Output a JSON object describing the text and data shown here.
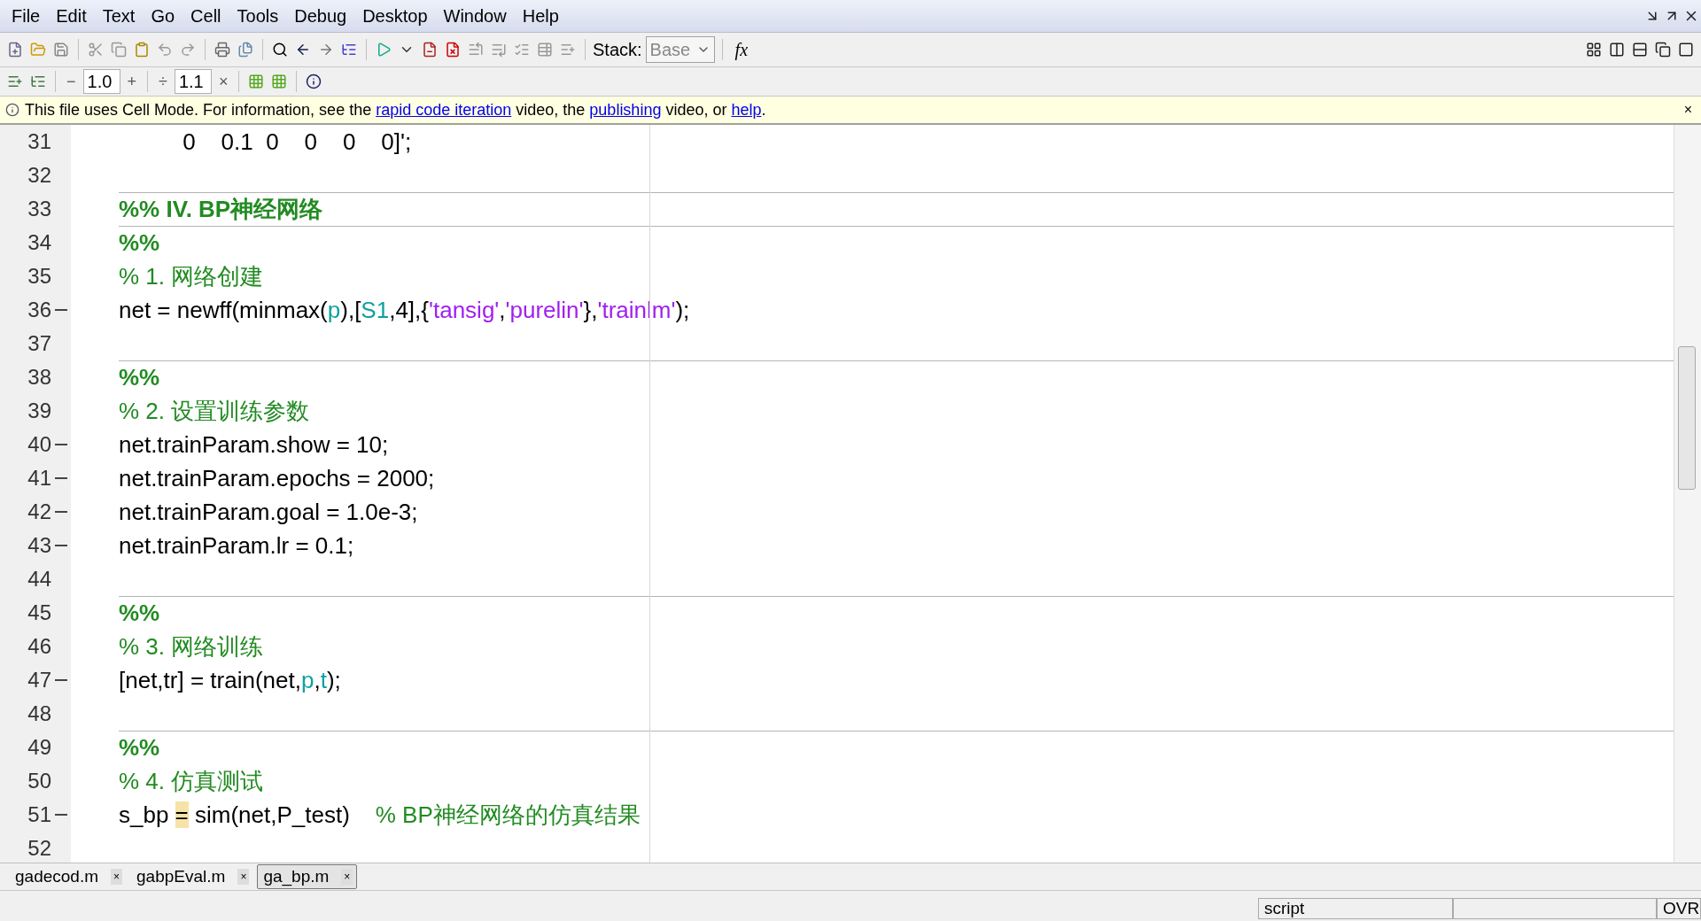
{
  "menu": [
    "File",
    "Edit",
    "Text",
    "Go",
    "Cell",
    "Tools",
    "Debug",
    "Desktop",
    "Window",
    "Help"
  ],
  "toolbar": {
    "stack_label": "Stack:",
    "stack_value": "Base",
    "function_button": "fx"
  },
  "cell_toolbar": {
    "minus": "−",
    "decrement": "1.0",
    "plus": "+",
    "divide": "÷",
    "factor": "1.1",
    "times": "×"
  },
  "info_bar": {
    "parts": [
      {
        "kind": "text",
        "text": "This file uses Cell Mode. For information, see the "
      },
      {
        "kind": "link",
        "text": "rapid code iteration"
      },
      {
        "kind": "text",
        "text": " video, the "
      },
      {
        "kind": "link",
        "text": "publishing"
      },
      {
        "kind": "text",
        "text": " video, or "
      },
      {
        "kind": "link",
        "text": "help"
      },
      {
        "kind": "text",
        "text": "."
      }
    ],
    "close": "×"
  },
  "lines": [
    {
      "number": "31",
      "executable": false,
      "tokens": [
        {
          "kind": "code",
          "text": "          0    0.1  0    0    0    0]';"
        }
      ]
    },
    {
      "number": "32",
      "executable": false
    },
    {
      "number": "33",
      "executable": false,
      "tokens": [
        {
          "kind": "cell",
          "text": "%% IV. BP神经网络"
        }
      ]
    },
    {
      "number": "34",
      "executable": false,
      "tokens": [
        {
          "kind": "cell",
          "text": "%%"
        }
      ]
    },
    {
      "number": "35",
      "executable": false,
      "tokens": [
        {
          "kind": "comment",
          "text": "% 1. 网络创建"
        }
      ]
    },
    {
      "number": "36",
      "executable": true,
      "tokens": [
        {
          "kind": "code",
          "text": "net = newff(minmax("
        },
        {
          "kind": "variable",
          "text": "p"
        },
        {
          "kind": "code",
          "text": "),["
        },
        {
          "kind": "variable",
          "text": "S1"
        },
        {
          "kind": "code",
          "text": ",4],{"
        },
        {
          "kind": "string",
          "text": "'tansig'"
        },
        {
          "kind": "code",
          "text": ","
        },
        {
          "kind": "string",
          "text": "'purelin'"
        },
        {
          "kind": "code",
          "text": "},"
        },
        {
          "kind": "string",
          "text": "'trainlm'"
        },
        {
          "kind": "code",
          "text": ");"
        }
      ]
    },
    {
      "number": "37",
      "executable": false
    },
    {
      "number": "38",
      "executable": false,
      "tokens": [
        {
          "kind": "cell",
          "text": "%%"
        }
      ]
    },
    {
      "number": "39",
      "executable": false,
      "tokens": [
        {
          "kind": "comment",
          "text": "% 2. 设置训练参数"
        }
      ]
    },
    {
      "number": "40",
      "executable": true,
      "tokens": [
        {
          "kind": "code",
          "text": "net.trainParam.show = 10;"
        }
      ]
    },
    {
      "number": "41",
      "executable": true,
      "tokens": [
        {
          "kind": "code",
          "text": "net.trainParam.epochs = 2000;"
        }
      ]
    },
    {
      "number": "42",
      "executable": true,
      "tokens": [
        {
          "kind": "code",
          "text": "net.trainParam.goal = 1.0e-3;"
        }
      ]
    },
    {
      "number": "43",
      "executable": true,
      "tokens": [
        {
          "kind": "code",
          "text": "net.trainParam.lr = 0.1;"
        }
      ]
    },
    {
      "number": "44",
      "executable": false
    },
    {
      "number": "45",
      "executable": false,
      "tokens": [
        {
          "kind": "cell",
          "text": "%%"
        }
      ]
    },
    {
      "number": "46",
      "executable": false,
      "tokens": [
        {
          "kind": "comment",
          "text": "% 3. 网络训练"
        }
      ]
    },
    {
      "number": "47",
      "executable": true,
      "tokens": [
        {
          "kind": "code",
          "text": "[net,tr] = train(net,"
        },
        {
          "kind": "variable",
          "text": "p"
        },
        {
          "kind": "code",
          "text": ","
        },
        {
          "kind": "variable",
          "text": "t"
        },
        {
          "kind": "code",
          "text": ");"
        }
      ]
    },
    {
      "number": "48",
      "executable": false
    },
    {
      "number": "49",
      "executable": false,
      "tokens": [
        {
          "kind": "cell",
          "text": "%%"
        }
      ]
    },
    {
      "number": "50",
      "executable": false,
      "tokens": [
        {
          "kind": "comment",
          "text": "% 4. 仿真测试"
        }
      ]
    },
    {
      "number": "51",
      "executable": true,
      "tokens": [
        {
          "kind": "code",
          "text": "s_bp "
        },
        {
          "kind": "highlight",
          "text": "="
        },
        {
          "kind": "code",
          "text": " sim(net,P_test)    "
        },
        {
          "kind": "comment",
          "text": "% BP神经网络的仿真结果"
        }
      ]
    },
    {
      "number": "52",
      "executable": false
    }
  ],
  "tabs": [
    {
      "label": "gadecod.m",
      "selected": false,
      "close": "×"
    },
    {
      "label": "gabpEval.m",
      "selected": false,
      "close": "×"
    },
    {
      "label": "ga_bp.m",
      "selected": true,
      "close": "×"
    }
  ],
  "status_bar": {
    "mode": "script",
    "overwrite": "OVR"
  }
}
